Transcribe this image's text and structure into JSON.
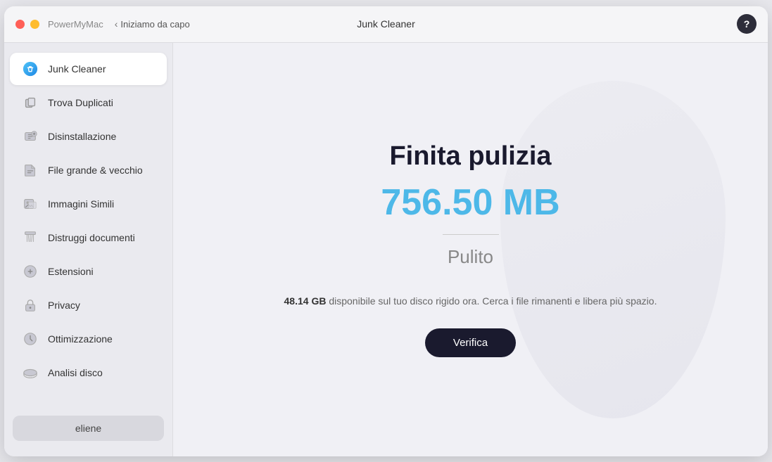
{
  "titleBar": {
    "appName": "PowerMyMac",
    "navBack": "Iniziamo da capo",
    "windowTitle": "Junk Cleaner",
    "helpLabel": "?"
  },
  "sidebar": {
    "items": [
      {
        "id": "junk-cleaner",
        "label": "Junk Cleaner",
        "active": true,
        "iconType": "junk"
      },
      {
        "id": "trova-duplicati",
        "label": "Trova Duplicati",
        "active": false,
        "iconType": "duplicate"
      },
      {
        "id": "disinstallazione",
        "label": "Disinstallazione",
        "active": false,
        "iconType": "uninstall"
      },
      {
        "id": "file-grande",
        "label": "File grande & vecchio",
        "active": false,
        "iconType": "file"
      },
      {
        "id": "immagini-simili",
        "label": "Immagini Simili",
        "active": false,
        "iconType": "image"
      },
      {
        "id": "distruggi-documenti",
        "label": "Distruggi documenti",
        "active": false,
        "iconType": "shred"
      },
      {
        "id": "estensioni",
        "label": "Estensioni",
        "active": false,
        "iconType": "extension"
      },
      {
        "id": "privacy",
        "label": "Privacy",
        "active": false,
        "iconType": "privacy"
      },
      {
        "id": "ottimizzazione",
        "label": "Ottimizzazione",
        "active": false,
        "iconType": "optimize"
      },
      {
        "id": "analisi-disco",
        "label": "Analisi disco",
        "active": false,
        "iconType": "disk"
      }
    ],
    "footer": {
      "userName": "eliene"
    }
  },
  "content": {
    "title": "Finita pulizia",
    "size": "756.50 MB",
    "statusLabel": "Pulito",
    "diskFreeLabel": "48.14 GB",
    "diskFreeText": " disponibile sul tuo disco rigido ora. Cerca i file rimanenti e libera più spazio.",
    "verifyButton": "Verifica"
  }
}
